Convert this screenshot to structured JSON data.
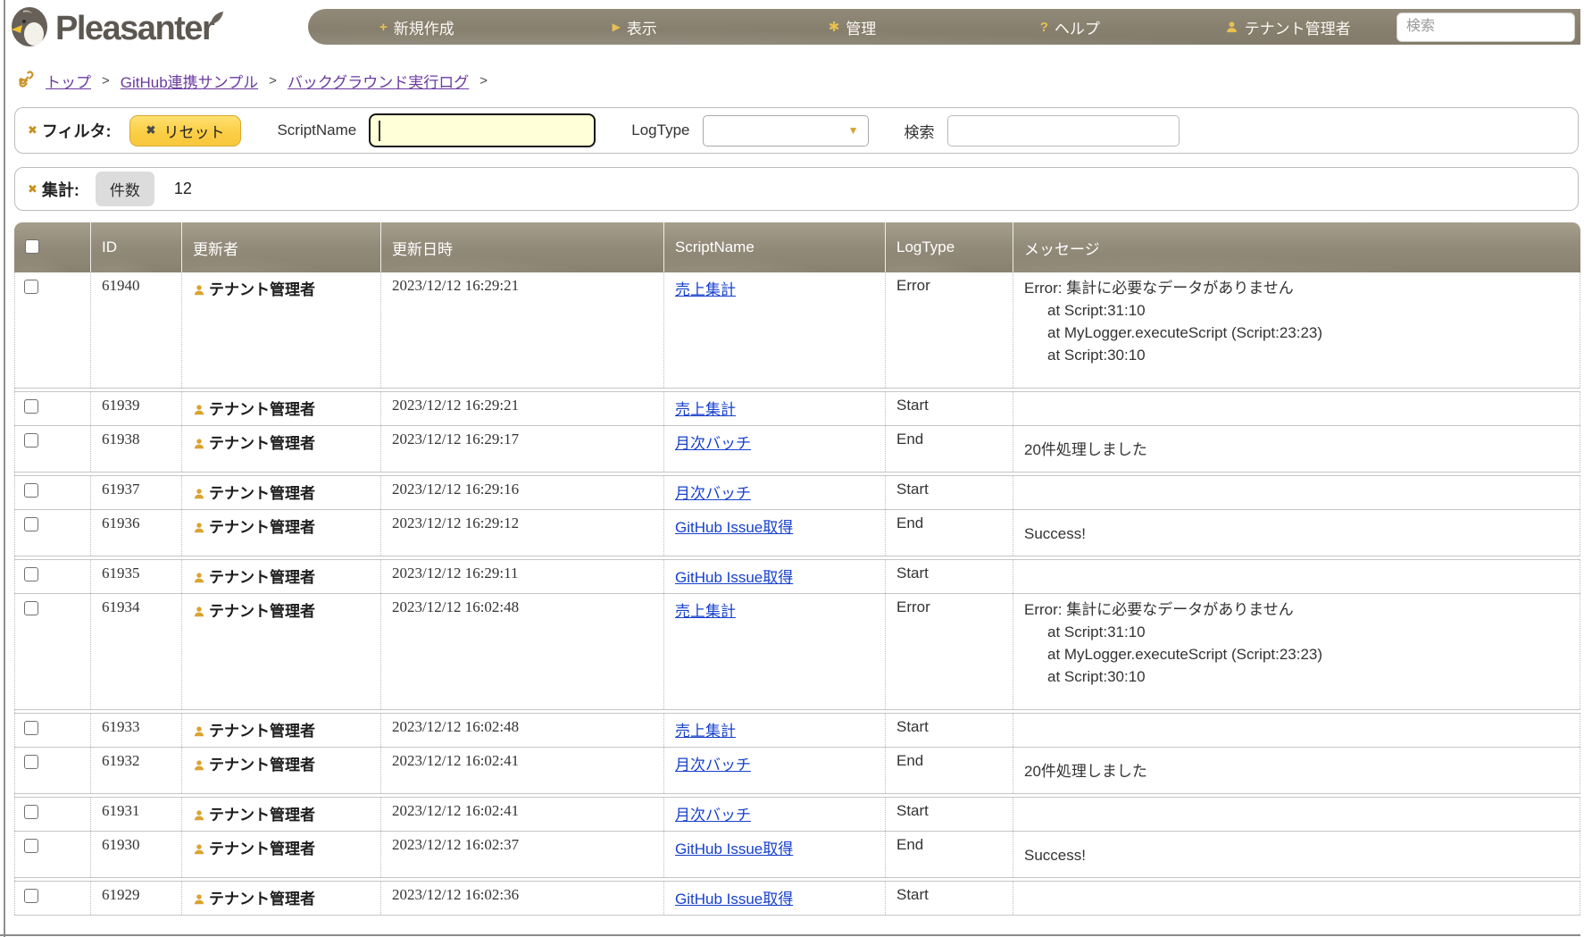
{
  "brand": {
    "name": "Pleasanter"
  },
  "icons": {
    "close": "✖",
    "plus": "+",
    "caret": "▶",
    "gear": "✱",
    "question": "?",
    "select_arrow": "▼"
  },
  "colors": {
    "nav_brown": "#8a8272",
    "accent_gold": "#e7c050",
    "reset_yellow": "#fbce46",
    "link_blue": "#1740cc",
    "breadcrumb_purple": "#6a3aa0",
    "focus_yellow": "#ffffd8"
  },
  "nav": {
    "items": [
      {
        "id": "create",
        "icon": "plus",
        "label": "新規作成"
      },
      {
        "id": "view",
        "icon": "caret",
        "label": "表示"
      },
      {
        "id": "admin",
        "icon": "gear",
        "label": "管理"
      },
      {
        "id": "help",
        "icon": "question",
        "label": "ヘルプ"
      },
      {
        "id": "account",
        "icon": "person",
        "label": "テナント管理者"
      }
    ],
    "search_placeholder": "検索"
  },
  "breadcrumb": {
    "separator": ">",
    "items": [
      "トップ",
      "GitHub連携サンプル",
      "バックグラウンド実行ログ"
    ]
  },
  "filters": {
    "title": "フィルタ:",
    "reset_label": "リセット",
    "script_name": {
      "label": "ScriptName",
      "value": "",
      "focused": true
    },
    "log_type": {
      "label": "LogType",
      "value": ""
    },
    "search": {
      "label": "検索",
      "value": ""
    }
  },
  "aggregations": {
    "title": "集計:",
    "items": [
      {
        "label": "件数",
        "value": "12"
      }
    ]
  },
  "table": {
    "columns": [
      "ID",
      "更新者",
      "更新日時",
      "ScriptName",
      "LogType",
      "メッセージ"
    ],
    "rows": [
      {
        "id": "61940",
        "updater": "テナント管理者",
        "updated": "2023/12/12 16:29:21",
        "script": "売上集計",
        "log_type": "Error",
        "message": [
          "Error: 集計に必要なデータがありません",
          "at Script:31:10",
          "at MyLogger.executeScript (Script:23:23)",
          "at Script:30:10"
        ]
      },
      {
        "id": "61939",
        "updater": "テナント管理者",
        "updated": "2023/12/12 16:29:21",
        "script": "売上集計",
        "log_type": "Start",
        "message": []
      },
      {
        "id": "61938",
        "updater": "テナント管理者",
        "updated": "2023/12/12 16:29:17",
        "script": "月次バッチ",
        "log_type": "End",
        "message": [
          "20件処理しました"
        ]
      },
      {
        "id": "61937",
        "updater": "テナント管理者",
        "updated": "2023/12/12 16:29:16",
        "script": "月次バッチ",
        "log_type": "Start",
        "message": []
      },
      {
        "id": "61936",
        "updater": "テナント管理者",
        "updated": "2023/12/12 16:29:12",
        "script": "GitHub Issue取得",
        "log_type": "End",
        "message": [
          "Success!"
        ]
      },
      {
        "id": "61935",
        "updater": "テナント管理者",
        "updated": "2023/12/12 16:29:11",
        "script": "GitHub Issue取得",
        "log_type": "Start",
        "message": []
      },
      {
        "id": "61934",
        "updater": "テナント管理者",
        "updated": "2023/12/12 16:02:48",
        "script": "売上集計",
        "log_type": "Error",
        "message": [
          "Error: 集計に必要なデータがありません",
          "at Script:31:10",
          "at MyLogger.executeScript (Script:23:23)",
          "at Script:30:10"
        ]
      },
      {
        "id": "61933",
        "updater": "テナント管理者",
        "updated": "2023/12/12 16:02:48",
        "script": "売上集計",
        "log_type": "Start",
        "message": []
      },
      {
        "id": "61932",
        "updater": "テナント管理者",
        "updated": "2023/12/12 16:02:41",
        "script": "月次バッチ",
        "log_type": "End",
        "message": [
          "20件処理しました"
        ]
      },
      {
        "id": "61931",
        "updater": "テナント管理者",
        "updated": "2023/12/12 16:02:41",
        "script": "月次バッチ",
        "log_type": "Start",
        "message": []
      },
      {
        "id": "61930",
        "updater": "テナント管理者",
        "updated": "2023/12/12 16:02:37",
        "script": "GitHub Issue取得",
        "log_type": "End",
        "message": [
          "Success!"
        ]
      },
      {
        "id": "61929",
        "updater": "テナント管理者",
        "updated": "2023/12/12 16:02:36",
        "script": "GitHub Issue取得",
        "log_type": "Start",
        "message": []
      }
    ]
  }
}
